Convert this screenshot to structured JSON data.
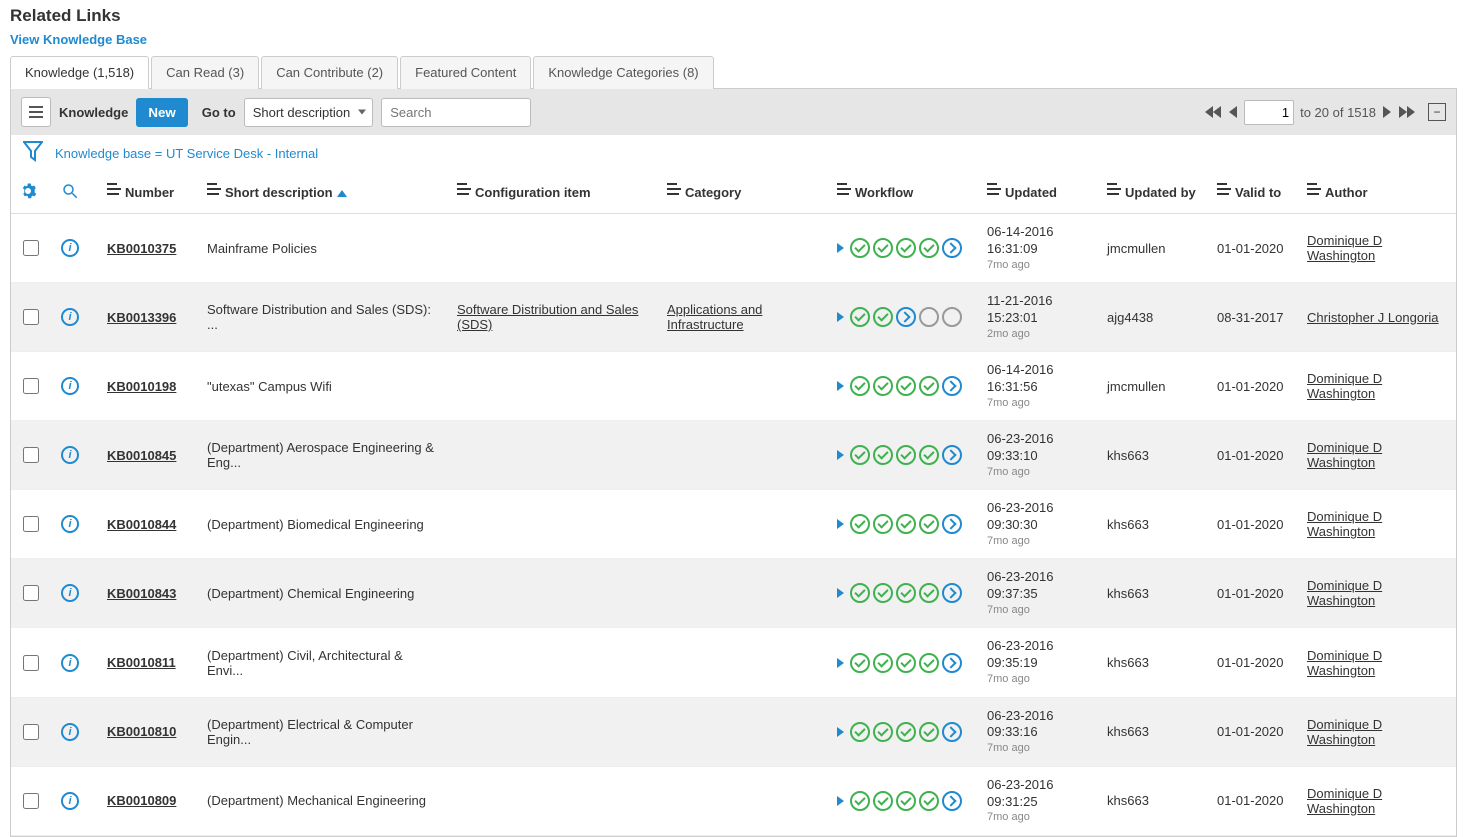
{
  "header": {
    "related_links": "Related Links",
    "view_kb": "View Knowledge Base"
  },
  "tabs": [
    {
      "label": "Knowledge (1,518)",
      "active": true
    },
    {
      "label": "Can Read (3)",
      "active": false
    },
    {
      "label": "Can Contribute (2)",
      "active": false
    },
    {
      "label": "Featured Content",
      "active": false
    },
    {
      "label": "Knowledge Categories (8)",
      "active": false
    }
  ],
  "toolbar": {
    "list_label": "Knowledge",
    "new_label": "New",
    "goto_label": "Go to",
    "goto_field": "Short description",
    "search_placeholder": "Search"
  },
  "pager": {
    "page": "1",
    "range": "to 20 of 1518"
  },
  "filter": {
    "text": "Knowledge base = UT Service Desk - Internal"
  },
  "columns": {
    "number": "Number",
    "short_desc": "Short description",
    "config_item": "Configuration item",
    "category": "Category",
    "workflow": "Workflow",
    "updated": "Updated",
    "updated_by": "Updated by",
    "valid_to": "Valid to",
    "author": "Author"
  },
  "rows": [
    {
      "number": "KB0010375",
      "short_desc": "Mainframe Policies",
      "config_item": "",
      "category": "",
      "workflow": [
        "green",
        "green",
        "green",
        "green",
        "blue"
      ],
      "updated": {
        "date": "06-14-2016",
        "time": "16:31:09",
        "ago": "7mo ago"
      },
      "updated_by": "jmcmullen",
      "valid_to": "01-01-2020",
      "author": "Dominique D Washington"
    },
    {
      "number": "KB0013396",
      "short_desc": "Software Distribution and Sales (SDS): ...",
      "config_item": "Software Distribution and Sales (SDS)",
      "category": "Applications and Infrastructure",
      "workflow": [
        "green",
        "green",
        "blue",
        "grey",
        "grey"
      ],
      "updated": {
        "date": "11-21-2016",
        "time": "15:23:01",
        "ago": "2mo ago"
      },
      "updated_by": "ajg4438",
      "valid_to": "08-31-2017",
      "author": "Christopher J Longoria"
    },
    {
      "number": "KB0010198",
      "short_desc": "\"utexas\" Campus Wifi",
      "config_item": "",
      "category": "",
      "workflow": [
        "green",
        "green",
        "green",
        "green",
        "blue"
      ],
      "updated": {
        "date": "06-14-2016",
        "time": "16:31:56",
        "ago": "7mo ago"
      },
      "updated_by": "jmcmullen",
      "valid_to": "01-01-2020",
      "author": "Dominique D Washington"
    },
    {
      "number": "KB0010845",
      "short_desc": "(Department) Aerospace Engineering & Eng...",
      "config_item": "",
      "category": "",
      "workflow": [
        "green",
        "green",
        "green",
        "green",
        "blue"
      ],
      "updated": {
        "date": "06-23-2016",
        "time": "09:33:10",
        "ago": "7mo ago"
      },
      "updated_by": "khs663",
      "valid_to": "01-01-2020",
      "author": "Dominique D Washington"
    },
    {
      "number": "KB0010844",
      "short_desc": "(Department) Biomedical Engineering",
      "config_item": "",
      "category": "",
      "workflow": [
        "green",
        "green",
        "green",
        "green",
        "blue"
      ],
      "updated": {
        "date": "06-23-2016",
        "time": "09:30:30",
        "ago": "7mo ago"
      },
      "updated_by": "khs663",
      "valid_to": "01-01-2020",
      "author": "Dominique D Washington"
    },
    {
      "number": "KB0010843",
      "short_desc": "(Department) Chemical Engineering",
      "config_item": "",
      "category": "",
      "workflow": [
        "green",
        "green",
        "green",
        "green",
        "blue"
      ],
      "updated": {
        "date": "06-23-2016",
        "time": "09:37:35",
        "ago": "7mo ago"
      },
      "updated_by": "khs663",
      "valid_to": "01-01-2020",
      "author": "Dominique D Washington"
    },
    {
      "number": "KB0010811",
      "short_desc": "(Department) Civil, Architectural & Envi...",
      "config_item": "",
      "category": "",
      "workflow": [
        "green",
        "green",
        "green",
        "green",
        "blue"
      ],
      "updated": {
        "date": "06-23-2016",
        "time": "09:35:19",
        "ago": "7mo ago"
      },
      "updated_by": "khs663",
      "valid_to": "01-01-2020",
      "author": "Dominique D Washington"
    },
    {
      "number": "KB0010810",
      "short_desc": "(Department) Electrical & Computer Engin...",
      "config_item": "",
      "category": "",
      "workflow": [
        "green",
        "green",
        "green",
        "green",
        "blue"
      ],
      "updated": {
        "date": "06-23-2016",
        "time": "09:33:16",
        "ago": "7mo ago"
      },
      "updated_by": "khs663",
      "valid_to": "01-01-2020",
      "author": "Dominique D Washington"
    },
    {
      "number": "KB0010809",
      "short_desc": "(Department) Mechanical Engineering",
      "config_item": "",
      "category": "",
      "workflow": [
        "green",
        "green",
        "green",
        "green",
        "blue"
      ],
      "updated": {
        "date": "06-23-2016",
        "time": "09:31:25",
        "ago": "7mo ago"
      },
      "updated_by": "khs663",
      "valid_to": "01-01-2020",
      "author": "Dominique D Washington"
    }
  ]
}
